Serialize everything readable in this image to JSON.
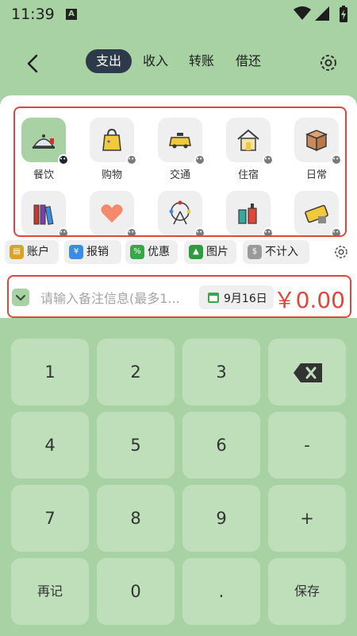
{
  "status": {
    "time": "11:39",
    "a_badge": "A"
  },
  "header": {
    "tabs": [
      {
        "label": "支出",
        "active": true
      },
      {
        "label": "收入",
        "active": false
      },
      {
        "label": "转账",
        "active": false
      },
      {
        "label": "借还",
        "active": false
      }
    ]
  },
  "categories": [
    {
      "label": "餐饮",
      "icon": "dining-icon",
      "selected": true
    },
    {
      "label": "购物",
      "icon": "shopping-bag-icon"
    },
    {
      "label": "交通",
      "icon": "taxi-icon"
    },
    {
      "label": "住宿",
      "icon": "house-icon"
    },
    {
      "label": "日常",
      "icon": "box-icon"
    },
    {
      "label": "",
      "icon": "books-icon"
    },
    {
      "label": "",
      "icon": "heart-icon"
    },
    {
      "label": "",
      "icon": "ferris-wheel-icon"
    },
    {
      "label": "",
      "icon": "cosmetics-icon"
    },
    {
      "label": "",
      "icon": "ticket-icon"
    }
  ],
  "chips": [
    {
      "label": "账户",
      "icon": "account-icon",
      "color": "#d8a32a"
    },
    {
      "label": "报销",
      "icon": "reimburse-icon",
      "color": "#3a8de0"
    },
    {
      "label": "优惠",
      "icon": "discount-icon",
      "color": "#3aa64a"
    },
    {
      "label": "图片",
      "icon": "image-icon",
      "color": "#2f9a3e"
    },
    {
      "label": "不计入",
      "icon": "exclude-icon",
      "color": "#9a9a9a"
    }
  ],
  "note": {
    "placeholder": "请输入备注信息(最多1...",
    "date": "9月16日",
    "amount": "￥0.00"
  },
  "keypad": {
    "keys": [
      "1",
      "2",
      "3",
      "",
      "4",
      "5",
      "6",
      "-",
      "7",
      "8",
      "9",
      "+",
      "再记",
      "0",
      ".",
      "保存"
    ]
  },
  "colors": {
    "accent": "#a8d1a4",
    "alert": "#e0463a",
    "dark": "#2d3a4a"
  }
}
